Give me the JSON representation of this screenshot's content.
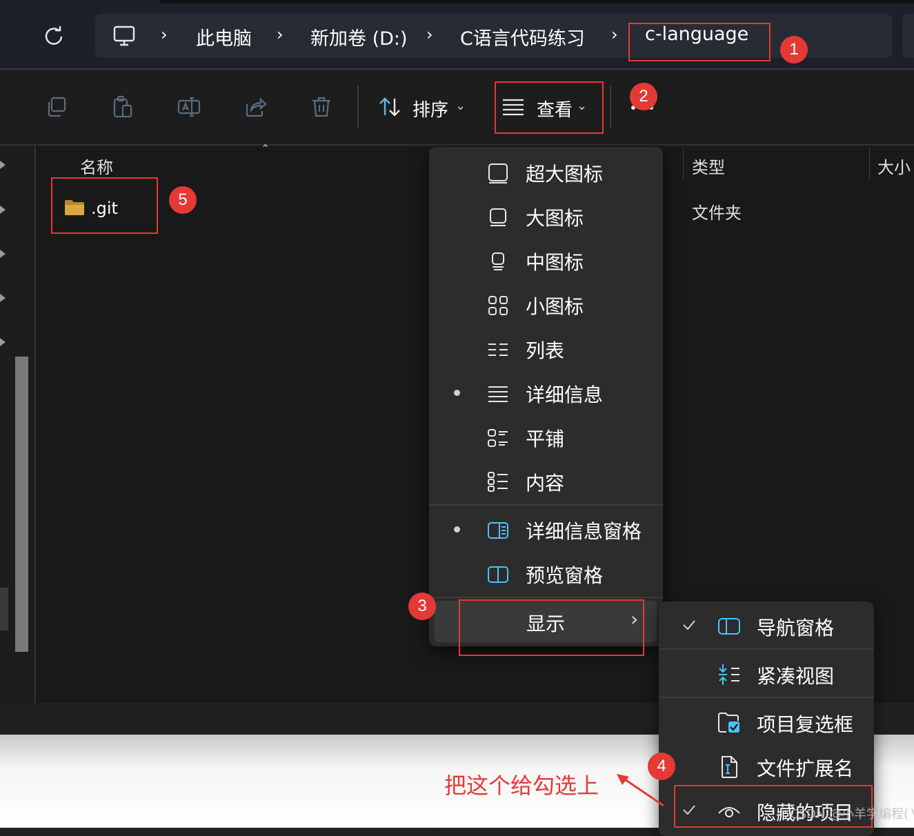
{
  "breadcrumb": {
    "items": [
      "此电脑",
      "新加卷 (D:)",
      "C语言代码练习",
      "c-language"
    ]
  },
  "toolbar": {
    "sort_label": "排序",
    "view_label": "查看"
  },
  "columns": {
    "name": "名称",
    "type": "类型",
    "size": "大小"
  },
  "files": [
    {
      "name": ".git",
      "type": "文件夹"
    }
  ],
  "view_menu": {
    "items": [
      {
        "label": "超大图标",
        "icon": "extra-large-icons-icon",
        "selected": false
      },
      {
        "label": "大图标",
        "icon": "large-icons-icon",
        "selected": false
      },
      {
        "label": "中图标",
        "icon": "medium-icons-icon",
        "selected": false
      },
      {
        "label": "小图标",
        "icon": "small-icons-icon",
        "selected": false
      },
      {
        "label": "列表",
        "icon": "list-icon",
        "selected": false
      },
      {
        "label": "详细信息",
        "icon": "details-icon",
        "selected": true
      },
      {
        "label": "平铺",
        "icon": "tiles-icon",
        "selected": false
      },
      {
        "label": "内容",
        "icon": "content-icon",
        "selected": false
      }
    ],
    "panes": [
      {
        "label": "详细信息窗格",
        "icon": "details-pane-icon",
        "selected": true
      },
      {
        "label": "预览窗格",
        "icon": "preview-pane-icon",
        "selected": false
      }
    ],
    "show_label": "显示"
  },
  "show_menu": {
    "items": [
      {
        "label": "导航窗格",
        "icon": "navigation-pane-icon",
        "checked": true
      },
      {
        "label": "紧凑视图",
        "icon": "compact-view-icon",
        "checked": false
      },
      {
        "label": "项目复选框",
        "icon": "item-checkbox-icon",
        "checked": false
      },
      {
        "label": "文件扩展名",
        "icon": "file-extension-icon",
        "checked": false
      },
      {
        "label": "隐藏的项目",
        "icon": "hidden-items-icon",
        "checked": true
      }
    ]
  },
  "annotations": {
    "badges": [
      "1",
      "2",
      "3",
      "4",
      "5"
    ],
    "instruction": "把这个给勾选上",
    "color": "#e53935"
  },
  "watermark": "CSDN @小羊学编程(㇏_㇏)",
  "colors": {
    "accent": "#4cc2ff",
    "annotation": "#e53935",
    "folder": "#d9a93f"
  }
}
